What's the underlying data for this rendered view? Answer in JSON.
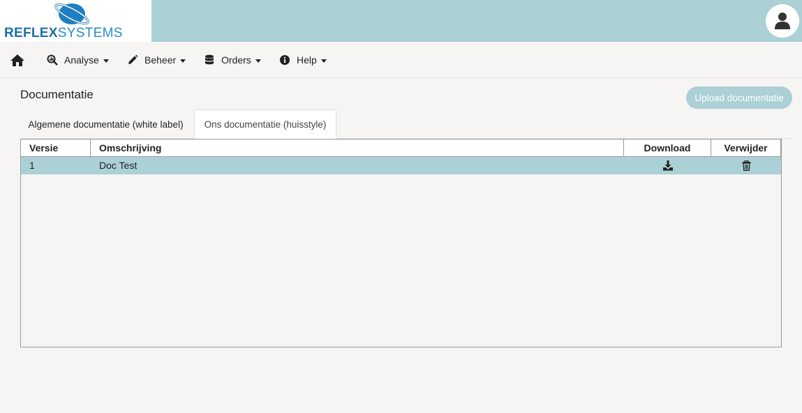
{
  "header": {
    "logo": {
      "part1": "REFLEX",
      "part2": "SYSTEMS"
    },
    "user_icon": "user-icon",
    "colors": {
      "topbar": "#abd0d6",
      "logo_blue": "#1d6fa8",
      "logo_light_blue": "#2a8cc6"
    }
  },
  "nav": {
    "home_icon": "home-icon",
    "items": [
      {
        "label": "Analyse",
        "icon": "chart-search-icon"
      },
      {
        "label": "Beheer",
        "icon": "pencil-icon"
      },
      {
        "label": "Orders",
        "icon": "database-icon"
      },
      {
        "label": "Help",
        "icon": "info-circle-icon"
      }
    ]
  },
  "page": {
    "title": "Documentatie",
    "upload_button": "Upload documentatie"
  },
  "tabs": [
    {
      "label": "Algemene documentatie (white label)",
      "active": false
    },
    {
      "label": "Ons documentatie (huisstyle)",
      "active": true
    }
  ],
  "table": {
    "columns": [
      "Versie",
      "Omschrijving",
      "Download",
      "Verwijder"
    ],
    "rows": [
      {
        "versie": "1",
        "omschrijving": "Doc Test",
        "download_icon": "download-icon",
        "delete_icon": "trash-icon",
        "selected": true
      }
    ],
    "row_highlight_color": "#abd0d6"
  }
}
